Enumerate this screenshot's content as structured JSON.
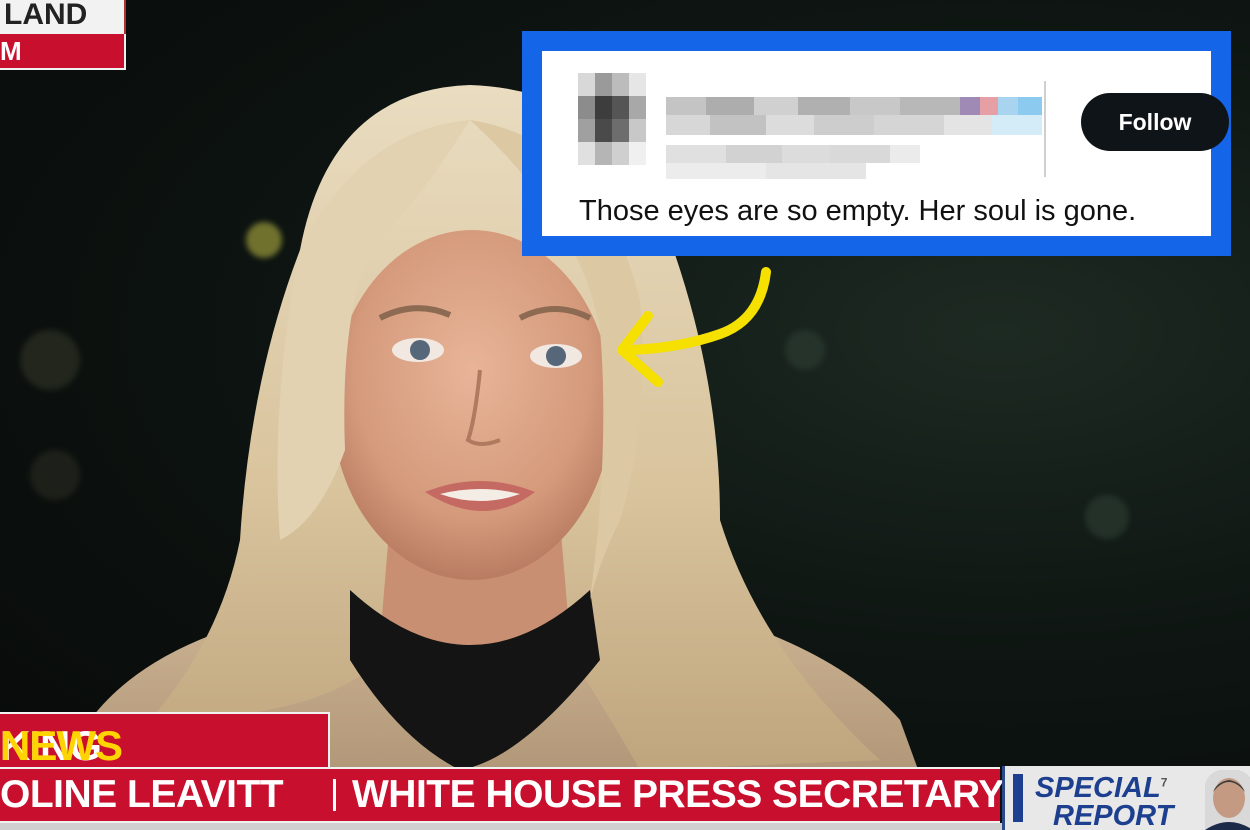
{
  "broadcast": {
    "corner_top": "LAND",
    "corner_bottom": "M",
    "breaking_white": "KING",
    "breaking_yellow": "NEWS",
    "lower_name": "OLINE LEAVITT",
    "lower_title": "WHITE HOUSE PRESS SECRETARY",
    "show_line1": "SPECIAL",
    "show_line2": "REPORT",
    "show_superscript": "7"
  },
  "tweet": {
    "follow_label": "Follow",
    "text": "Those eyes are so empty. Her soul is gone.",
    "frame_color": "#1565e8"
  },
  "annotation": {
    "arrow_color": "#f5e000"
  }
}
